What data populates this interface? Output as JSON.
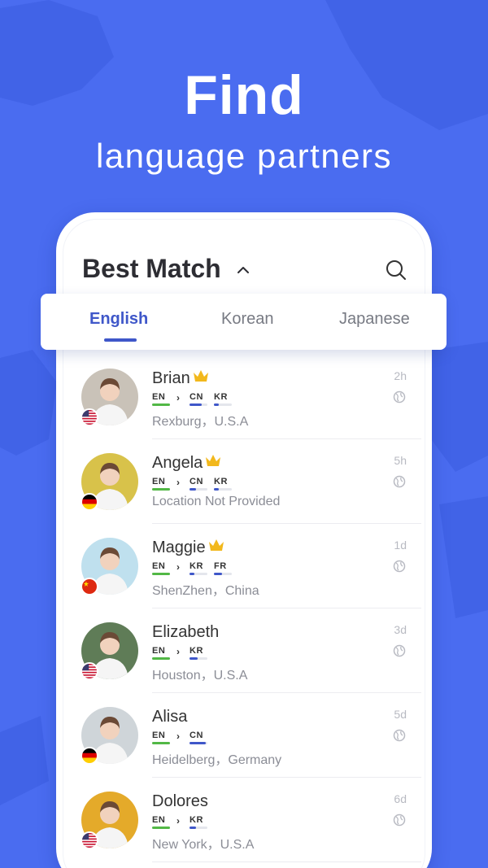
{
  "hero": {
    "title": "Find",
    "subtitle": "language partners"
  },
  "header": {
    "title": "Best Match"
  },
  "tabs": [
    {
      "label": "English",
      "active": true
    },
    {
      "label": "Korean",
      "active": false
    },
    {
      "label": "Japanese",
      "active": false
    }
  ],
  "colors": {
    "brand": "#4a6cf0",
    "accent": "#3f57c9",
    "native_bar": "#52b846",
    "learn_bar": "#3f57c9",
    "crown": "#f2b81c"
  },
  "users": [
    {
      "name": "Brian",
      "premium": true,
      "native": "EN",
      "learning": [
        "CN",
        "KR"
      ],
      "learning_levels": [
        0.7,
        0.25
      ],
      "location": "Rexburg，U.S.A",
      "time": "2h",
      "flag": "us",
      "avatar_bg": "#c9c2b8"
    },
    {
      "name": "Angela",
      "premium": true,
      "native": "EN",
      "learning": [
        "CN",
        "KR"
      ],
      "learning_levels": [
        0.35,
        0.25
      ],
      "location": "Location Not Provided",
      "time": "5h",
      "flag": "de",
      "avatar_bg": "#d8c24a"
    },
    {
      "name": "Maggie",
      "premium": true,
      "native": "EN",
      "learning": [
        "KR",
        "FR"
      ],
      "learning_levels": [
        0.25,
        0.45
      ],
      "location": "ShenZhen，China",
      "time": "1d",
      "flag": "cn",
      "avatar_bg": "#bfe0ee"
    },
    {
      "name": "Elizabeth",
      "premium": false,
      "native": "EN",
      "learning": [
        "KR"
      ],
      "learning_levels": [
        0.45
      ],
      "location": "Houston，U.S.A",
      "time": "3d",
      "flag": "us",
      "avatar_bg": "#5f7c57"
    },
    {
      "name": "Alisa",
      "premium": false,
      "native": "EN",
      "learning": [
        "CN"
      ],
      "learning_levels": [
        0.9
      ],
      "location": "Heidelberg，Germany",
      "time": "5d",
      "flag": "de",
      "avatar_bg": "#cfd5d9"
    },
    {
      "name": "Dolores",
      "premium": false,
      "native": "EN",
      "learning": [
        "KR"
      ],
      "learning_levels": [
        0.35
      ],
      "location": "New York，U.S.A",
      "time": "6d",
      "flag": "us",
      "avatar_bg": "#e4aa2a"
    }
  ]
}
